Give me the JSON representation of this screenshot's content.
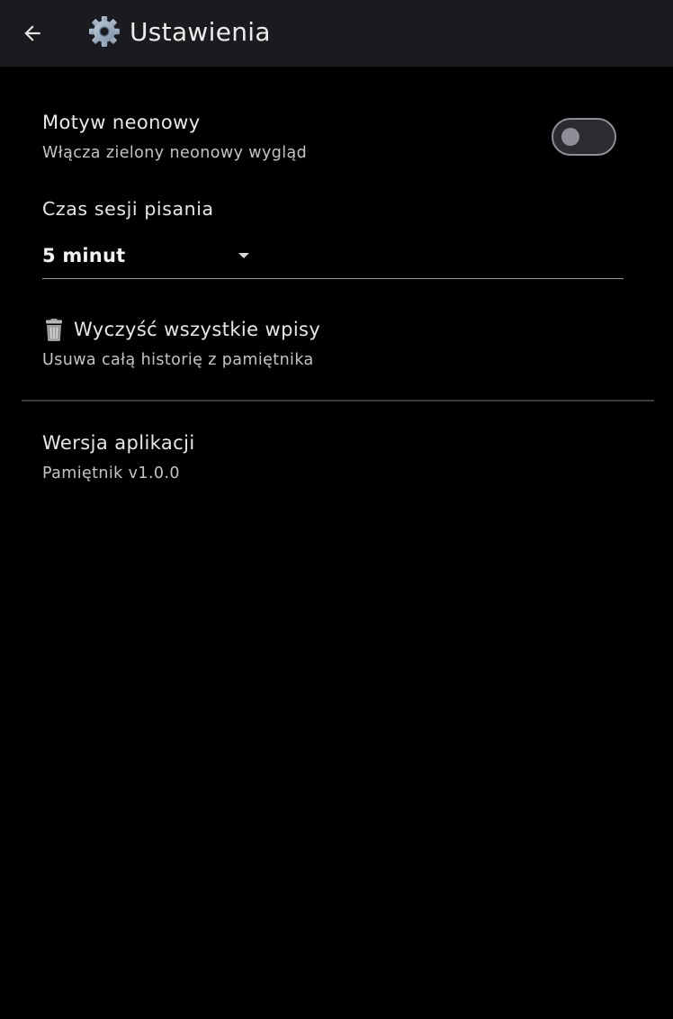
{
  "app_bar": {
    "title": "Ustawienia",
    "back_icon": "arrow-left-icon",
    "title_icon": "gear-icon"
  },
  "settings": {
    "neon_theme": {
      "title": "Motyw neonowy",
      "subtitle": "Włącza zielony neonowy wygląd",
      "enabled": false
    },
    "session": {
      "label": "Czas sesji pisania",
      "selected": "5 minut"
    },
    "clear_entries": {
      "title": "Wyczyść wszystkie wpisy",
      "subtitle": "Usuwa całą historię z pamiętnika",
      "icon": "trash-icon"
    },
    "version": {
      "title": "Wersja aplikacji",
      "value": "Pamiętnik v1.0.0"
    }
  },
  "colors": {
    "background": "#000000",
    "app_bar": "#1b1b1f",
    "toggle_off": "#8e8e96"
  }
}
